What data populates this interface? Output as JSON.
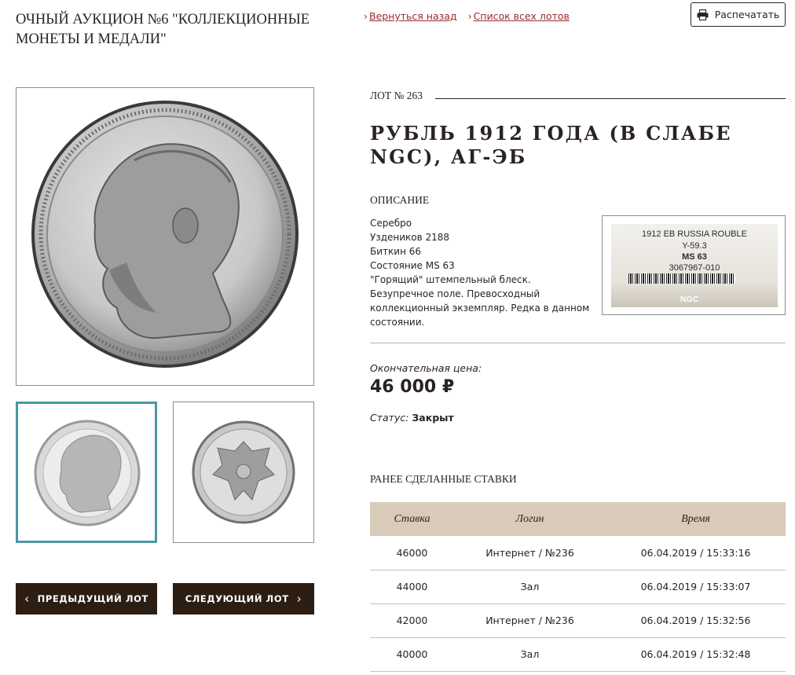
{
  "auction": {
    "title": "ОЧНЫЙ АУКЦИОН №6 \"КОЛЛЕКЦИОННЫЕ МОНЕТЫ И МЕДАЛИ\""
  },
  "top_links": {
    "back": "Вернуться назад",
    "all_lots": "Список всех лотов"
  },
  "print_button": {
    "label": "Распечатать",
    "icon": "printer-icon"
  },
  "lot": {
    "number_label": "ЛОТ № 263",
    "title": "РУБЛЬ 1912 ГОДА (В СЛАБЕ NGC), АГ-ЭБ",
    "description_heading": "ОПИСАНИЕ",
    "description_lines": [
      "Серебро",
      "Уздеников 2188",
      "Биткин 66",
      "Состояние MS 63",
      "\"Горящий\" штемпельный блеск. Безупречное поле. Превосходный коллекционный экземпляр. Редка в данном состоянии."
    ],
    "slab_label": {
      "line1": "1912 EB RUSSIA ROUBLE",
      "line2": "Y-59.3",
      "line3": "MS 63",
      "line4": "3067967-010",
      "logo": "NGC"
    },
    "final_price_label": "Окончательная цена:",
    "final_price": "46 000 ₽",
    "status_label": "Статус:",
    "status_value": "Закрыт"
  },
  "navigation": {
    "prev": "ПРЕДЫДУЩИЙ ЛОТ",
    "next": "СЛЕДУЮЩИЙ ЛОТ"
  },
  "bids": {
    "heading": "РАНЕЕ СДЕЛАННЫЕ СТАВКИ",
    "columns": [
      "Ставка",
      "Логин",
      "Время"
    ],
    "rows": [
      [
        "46000",
        "Интернет / №236",
        "06.04.2019 / 15:33:16"
      ],
      [
        "44000",
        "Зал",
        "06.04.2019 / 15:33:07"
      ],
      [
        "42000",
        "Интернет / №236",
        "06.04.2019 / 15:32:56"
      ],
      [
        "40000",
        "Зал",
        "06.04.2019 / 15:32:48"
      ]
    ]
  },
  "colors": {
    "link": "#9b2a2a",
    "dark_button": "#2d1e14",
    "table_header": "#d9cbb9",
    "selected_thumb_border": "#4a97a6"
  }
}
